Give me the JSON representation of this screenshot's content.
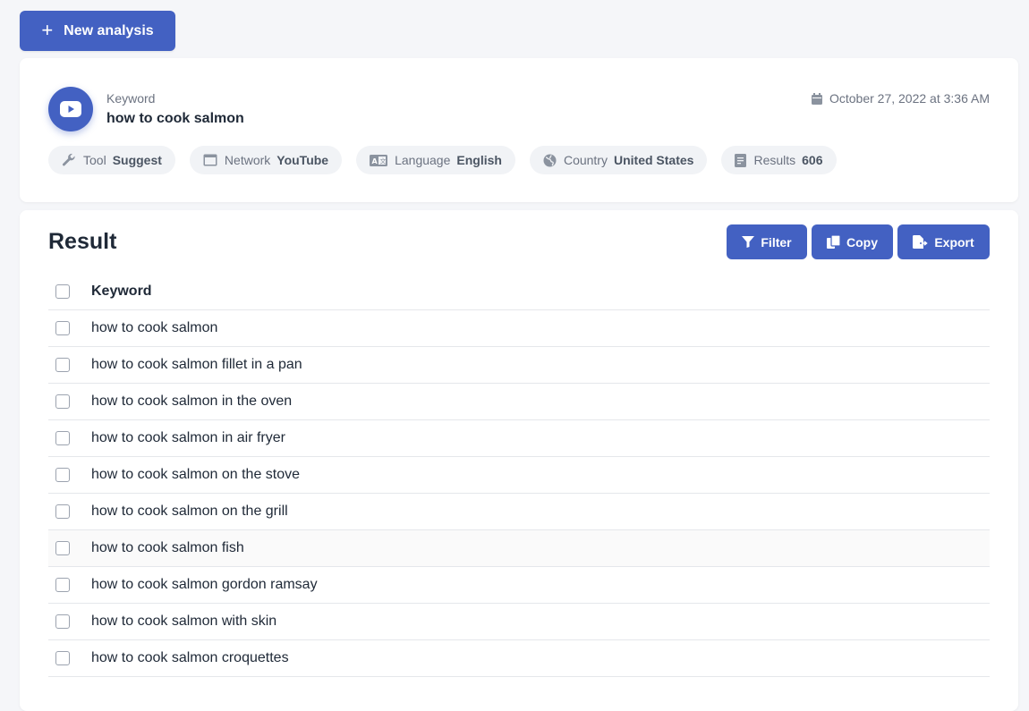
{
  "new_analysis": {
    "label": "New analysis"
  },
  "info": {
    "keyword_label": "Keyword",
    "keyword_value": "how to cook salmon",
    "date": "October 27, 2022 at 3:36 AM",
    "chips": [
      {
        "label": "Tool",
        "value": "Suggest",
        "icon": "wrench-icon"
      },
      {
        "label": "Network",
        "value": "YouTube",
        "icon": "window-icon"
      },
      {
        "label": "Language",
        "value": "English",
        "icon": "translate-icon"
      },
      {
        "label": "Country",
        "value": "United States",
        "icon": "globe-icon"
      },
      {
        "label": "Results",
        "value": "606",
        "icon": "document-icon"
      }
    ]
  },
  "result": {
    "title": "Result",
    "filter_label": "Filter",
    "copy_label": "Copy",
    "export_label": "Export",
    "column_header": "Keyword",
    "rows": [
      "how to cook salmon",
      "how to cook salmon fillet in a pan",
      "how to cook salmon in the oven",
      "how to cook salmon in air fryer",
      "how to cook salmon on the stove",
      "how to cook salmon on the grill",
      "how to cook salmon fish",
      "how to cook salmon gordon ramsay",
      "how to cook salmon with skin",
      "how to cook salmon croquettes"
    ]
  },
  "colors": {
    "accent": "#4361c2",
    "chip_bg": "#f1f3f6"
  }
}
